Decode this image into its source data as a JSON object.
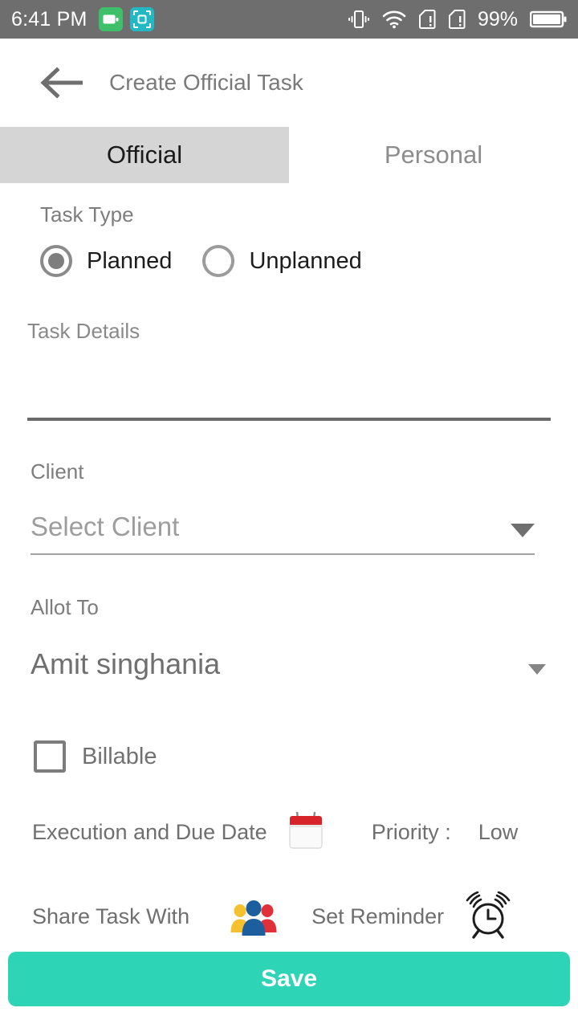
{
  "statusbar": {
    "time": "6:41 PM",
    "battery_percent": "99%",
    "icons": {
      "battery_saver_app": "battery-saver-icon",
      "screenshot_app": "screen-capture-icon",
      "vibrate": "vibrate-icon",
      "wifi": "wifi-icon",
      "sim1": "no-sim-1-icon",
      "sim2": "no-sim-2-icon",
      "battery": "battery-icon"
    },
    "colors": {
      "bar_bg": "#6e6e6e",
      "battery_saver_bg": "#3ec06a",
      "screen_capture_bg": "#22b8c4"
    }
  },
  "header": {
    "back_icon": "back-arrow-icon",
    "title": "Create Official Task"
  },
  "tabs": {
    "items": [
      {
        "label": "Official",
        "active": true
      },
      {
        "label": "Personal",
        "active": false
      }
    ],
    "active_bg": "#d5d5d5"
  },
  "form": {
    "task_type": {
      "label": "Task Type",
      "options": [
        {
          "label": "Planned",
          "selected": true
        },
        {
          "label": "Unplanned",
          "selected": false
        }
      ]
    },
    "task_details": {
      "label": "Task Details",
      "value": "",
      "placeholder": ""
    },
    "client": {
      "label": "Client",
      "value": "",
      "placeholder": "Select Client",
      "dropdown_icon": "chevron-down-icon"
    },
    "allot_to": {
      "label": "Allot To",
      "value": "Amit singhania",
      "dropdown_icon": "chevron-down-icon"
    },
    "billable": {
      "label": "Billable",
      "checked": false
    },
    "execution_due_date": {
      "label": "Execution and Due Date",
      "icon": "calendar-icon"
    },
    "priority": {
      "label": "Priority :",
      "value": "Low"
    },
    "share_task_with": {
      "label": "Share Task With",
      "icon": "people-group-icon"
    },
    "set_reminder": {
      "label": "Set Reminder",
      "icon": "alarm-clock-icon"
    }
  },
  "footer": {
    "save_label": "Save",
    "save_color": "#2dd4b5"
  }
}
